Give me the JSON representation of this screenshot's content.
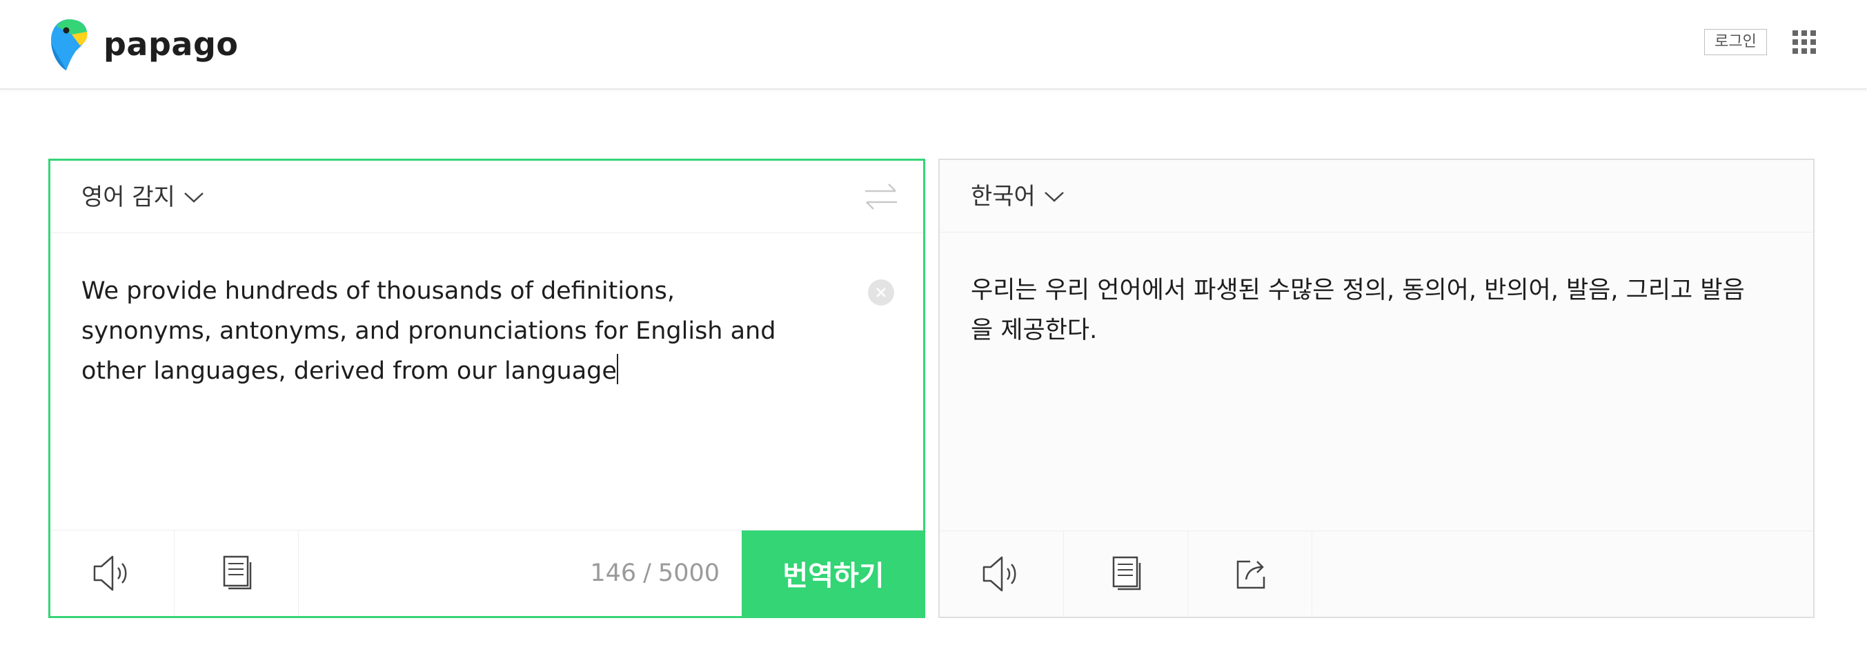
{
  "header": {
    "logo_text": "papago",
    "login_label": "로그인",
    "apps_icon": "grid-icon"
  },
  "source": {
    "language": "영어 감지",
    "text": "We provide hundreds of thousands of definitions, synonyms, antonyms, and pronunciations for English and other languages, derived from our language",
    "char_count": "146",
    "char_limit": "5000",
    "count_separator": "/",
    "translate_label": "번역하기",
    "icons": [
      "speaker-icon",
      "copy-icon",
      "swap-icon",
      "clear-icon"
    ]
  },
  "target": {
    "language": "한국어",
    "text": "우리는 우리 언어에서 파생된 수많은 정의, 동의어, 반의어, 발음, 그리고 발음을 제공한다.",
    "icons": [
      "speaker-icon",
      "copy-icon",
      "share-icon"
    ]
  },
  "colors": {
    "accent": "#33d575",
    "border": "#dedede"
  }
}
